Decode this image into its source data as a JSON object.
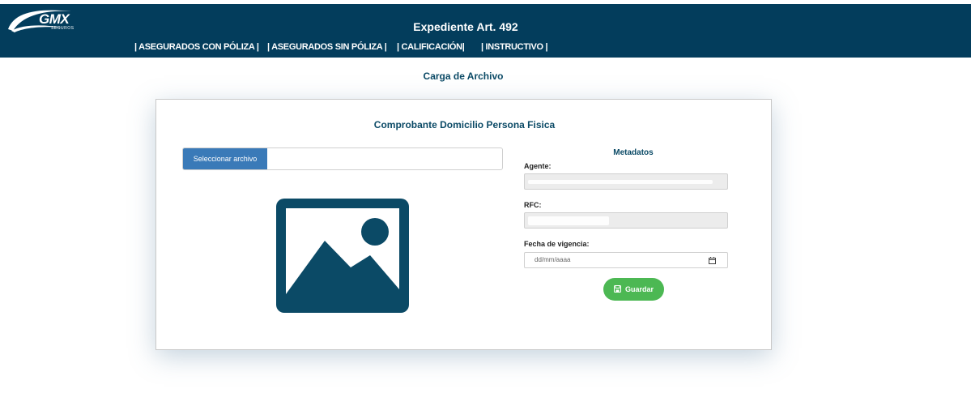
{
  "header": {
    "logo_text": "GMX",
    "logo_subtext": "SEGUROS",
    "title": "Expediente Art. 492"
  },
  "nav": {
    "items": [
      {
        "label": "| ASEGURADOS CON PÓLIZA |"
      },
      {
        "label": "| ASEGURADOS SIN PÓLIZA |"
      },
      {
        "label": "| CALIFICACIÓN|"
      },
      {
        "label": "| INSTRUCTIVO |"
      }
    ]
  },
  "page": {
    "title": "Carga de Archivo"
  },
  "card": {
    "title": "Comprobante Domicilio Persona Fisica",
    "file_button_label": "Seleccionar archivo",
    "metadata": {
      "title": "Metadatos",
      "agent_label": "Agente:",
      "rfc_label": "RFC:",
      "date_label": "Fecha de vigencia:",
      "date_placeholder": "dd/mm/aaaa"
    },
    "save_label": "Guardar"
  },
  "colors": {
    "header_bg": "#033d5c",
    "accent_blue": "#3a7ab8",
    "title_color": "#0b4a66",
    "save_green": "#4cb853",
    "image_icon": "#0b4a66"
  },
  "icons": [
    "image-placeholder-icon",
    "calendar-icon",
    "save-icon"
  ]
}
